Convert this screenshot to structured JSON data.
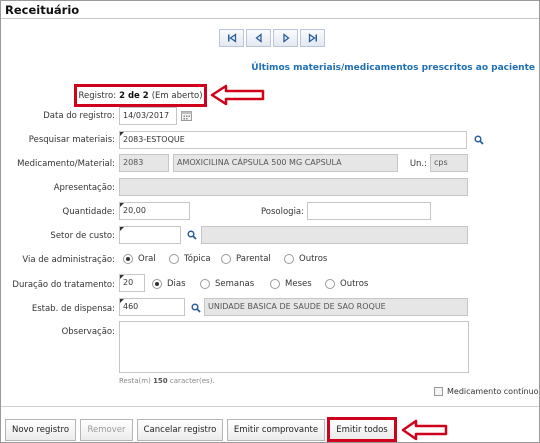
{
  "header": {
    "title": "Receituário"
  },
  "pager": {
    "icons": [
      "first-page-icon",
      "previous-page-icon",
      "next-page-icon",
      "last-page-icon"
    ]
  },
  "ultimos_link": "Últimos materiais/medicamentos prescritos ao paciente",
  "registro": {
    "label": "Registro:",
    "value": "2 de 2",
    "status": "(Em aberto)"
  },
  "form": {
    "data_registro": {
      "label": "Data do registro:",
      "value": "14/03/2017"
    },
    "pesquisar": {
      "label": "Pesquisar materiais:",
      "value": "2083-ESTOQUE"
    },
    "medicamento": {
      "label": "Medicamento/Material:",
      "code": "2083",
      "name": "AMOXICILINA CÁPSULA 500 MG CAPSULA",
      "un_label": "Un.:",
      "un_value": "cps"
    },
    "apresentacao": {
      "label": "Apresentação:",
      "value": ""
    },
    "quantidade": {
      "label": "Quantidade:",
      "value": "20,00"
    },
    "posologia": {
      "label": "Posologia:",
      "value": ""
    },
    "setor_custo": {
      "label": "Setor de custo:",
      "value": "",
      "name": ""
    },
    "via_admin": {
      "label": "Via de administração:",
      "options": [
        "Oral",
        "Tópica",
        "Parental",
        "Outros"
      ],
      "selected": "Oral"
    },
    "duracao": {
      "label": "Duração do tratamento:",
      "value": "20",
      "options": [
        "Dias",
        "Semanas",
        "Meses",
        "Outros"
      ],
      "selected": "Dias"
    },
    "estab": {
      "label": "Estab. de dispensa:",
      "code": "460",
      "name": "UNIDADE BASICA DE SAUDE DE SAO ROQUE"
    },
    "observacao": {
      "label": "Observação:",
      "value": ""
    },
    "resta": {
      "prefix": "Resta(m)",
      "count": "150",
      "suffix": "caracter(es)."
    },
    "medicamento_continuo": {
      "label": "Medicamento contínuo",
      "checked": false
    }
  },
  "buttons": {
    "novo": "Novo registro",
    "remover": "Remover",
    "cancelar": "Cancelar registro",
    "emitir_comprovante": "Emitir comprovante",
    "emitir_todos": "Emitir todos"
  },
  "colors": {
    "highlight": "#d0021b",
    "link": "#1f6fb5",
    "readonly_bg": "#e6e6e6"
  }
}
